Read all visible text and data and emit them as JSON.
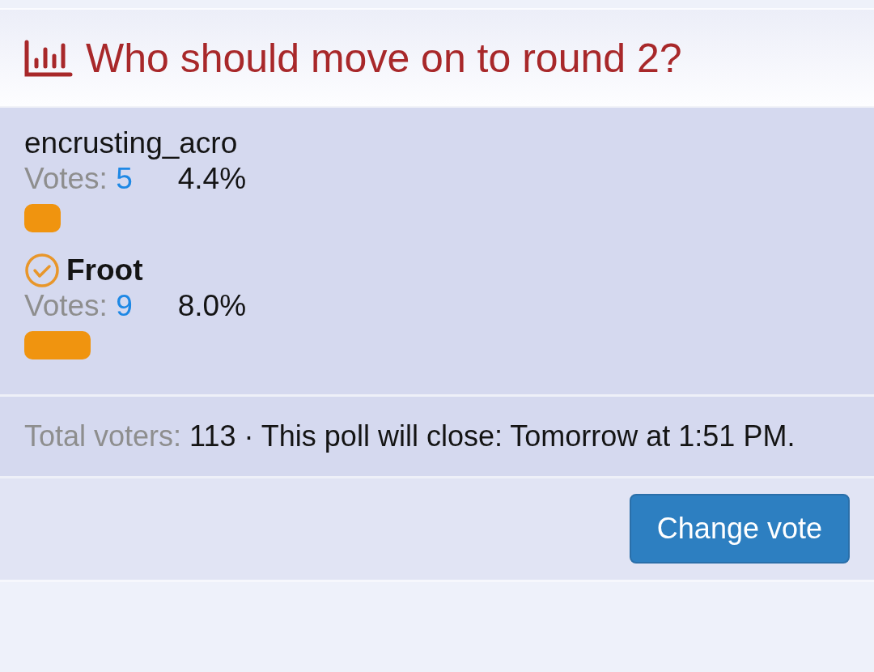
{
  "poll": {
    "title": "Who should move on to round 2?"
  },
  "options": [
    {
      "name": "encrusting_acro",
      "selected": false,
      "votes_label": "Votes:",
      "votes": "5",
      "percent": "4.4%",
      "level": 0.044
    },
    {
      "name": "Froot",
      "selected": true,
      "votes_label": "Votes:",
      "votes": "9",
      "percent": "8.0%",
      "level": 0.08
    }
  ],
  "footer": {
    "label": "Total voters:",
    "text": "113 · This poll will close: Tomorrow at 1:51 PM."
  },
  "buttons": [
    "Change vote"
  ]
}
